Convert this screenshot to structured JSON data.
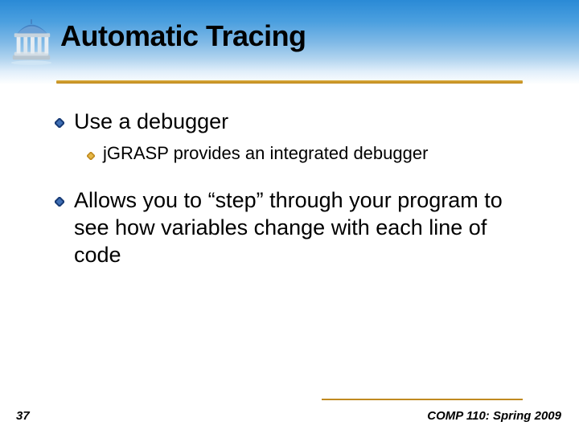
{
  "slide": {
    "title": "Automatic Tracing",
    "bullets": [
      {
        "level": 1,
        "text": "Use a debugger"
      },
      {
        "level": 2,
        "text": "jGRASP provides an integrated debugger"
      },
      {
        "level": 1,
        "text": "Allows you to “step” through your program to see how variables change with each line of code"
      }
    ]
  },
  "footer": {
    "page_number": "37",
    "course": "COMP 110: Spring 2009"
  },
  "icons": {
    "logo": "unc-old-well-icon",
    "bullet": "diamond-bullet-icon"
  }
}
